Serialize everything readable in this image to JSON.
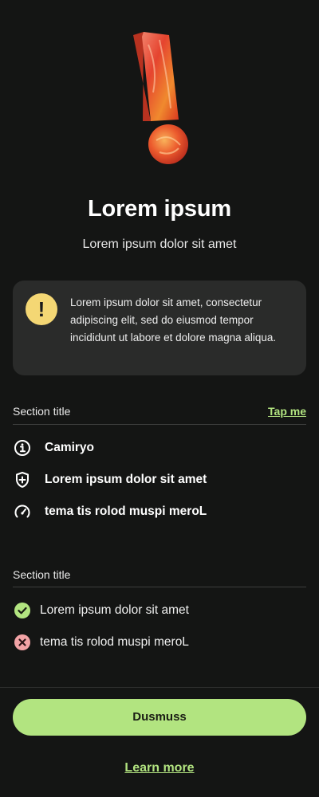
{
  "hero": {
    "icon": "exclamation-illustration"
  },
  "header": {
    "title": "Lorem ipsum",
    "subtitle": "Lorem ipsum dolor sit amet"
  },
  "notice": {
    "icon": "warning-icon",
    "glyph": "!",
    "text": "Lorem ipsum dolor sit amet, consectetur adipiscing elit, sed do eiusmod tempor incididunt ut labore et dolore magna aliqua."
  },
  "section1": {
    "title": "Section title",
    "action": "Tap me",
    "items": [
      {
        "icon": "info-icon",
        "label": "Camiryo"
      },
      {
        "icon": "shield-plus-icon",
        "label": "Lorem ipsum dolor sit amet"
      },
      {
        "icon": "speedometer-icon",
        "label": "tema tis rolod muspi meroL"
      }
    ]
  },
  "section2": {
    "title": "Section title",
    "items": [
      {
        "icon": "check-circle-icon",
        "label": "Lorem ipsum dolor sit amet",
        "status_color": "#b2e480"
      },
      {
        "icon": "cross-circle-icon",
        "label": "tema tis rolod muspi meroL",
        "status_color": "#f2a3a6"
      }
    ]
  },
  "footer": {
    "primary_button": "Dusmuss",
    "secondary_link": "Learn more"
  },
  "colors": {
    "accent": "#b2e480",
    "warning": "#f4d774",
    "error": "#f2a3a6",
    "background": "#141514"
  }
}
